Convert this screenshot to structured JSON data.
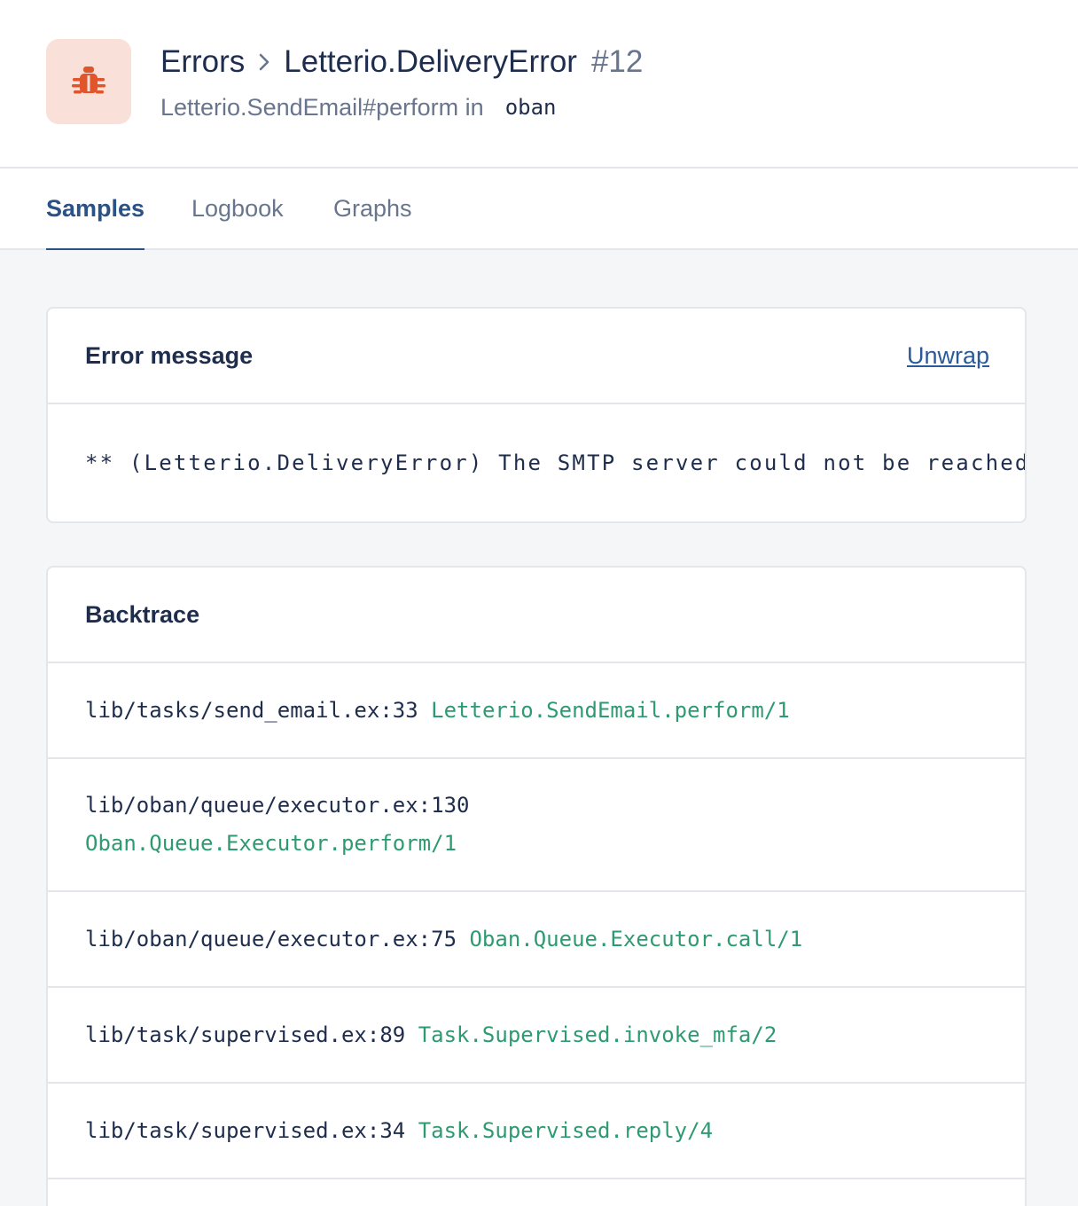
{
  "header": {
    "breadcrumb_root": "Errors",
    "error_name": "Letterio.DeliveryError",
    "error_number": "#12",
    "subtitle_action": "Letterio.SendEmail#perform in",
    "subtitle_namespace": "oban",
    "badge_icon": "bug-icon",
    "badge_color": "#e0552b"
  },
  "tabs": [
    {
      "label": "Samples",
      "active": true
    },
    {
      "label": "Logbook",
      "active": false
    },
    {
      "label": "Graphs",
      "active": false
    }
  ],
  "error_message": {
    "title": "Error message",
    "action_label": "Unwrap",
    "text": "** (Letterio.DeliveryError) The SMTP server could not be reached"
  },
  "backtrace": {
    "title": "Backtrace",
    "frames": [
      {
        "location": "lib/tasks/send_email.ex:33",
        "function": "Letterio.SendEmail.perform/1"
      },
      {
        "location": "lib/oban/queue/executor.ex:130",
        "function": "Oban.Queue.Executor.perform/1"
      },
      {
        "location": "lib/oban/queue/executor.ex:75",
        "function": "Oban.Queue.Executor.call/1"
      },
      {
        "location": "lib/task/supervised.ex:89",
        "function": "Task.Supervised.invoke_mfa/2"
      },
      {
        "location": "lib/task/supervised.ex:34",
        "function": "Task.Supervised.reply/4"
      }
    ]
  },
  "colors": {
    "accent": "#2a5285",
    "function_green": "#2e9a72",
    "muted_text": "#68758c"
  }
}
